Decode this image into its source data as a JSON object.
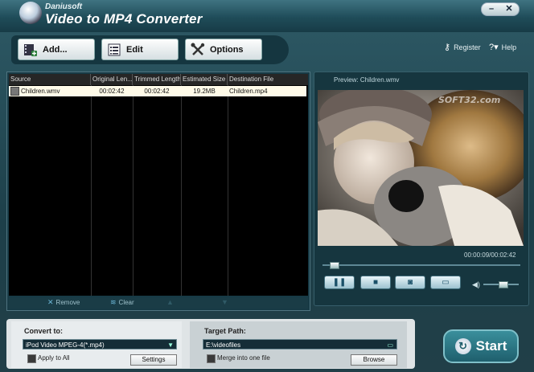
{
  "window": {
    "brand": "Daniusoft",
    "title": "Video to MP4 Converter",
    "controls": {
      "minimize": "–",
      "close": "✕"
    }
  },
  "toolbar": {
    "add_label": "Add...",
    "edit_label": "Edit",
    "options_label": "Options"
  },
  "header_links": {
    "register": "Register",
    "help": "Help"
  },
  "file_list": {
    "columns": [
      "Source",
      "Original Len...",
      "Trimmed Length",
      "Estimated Size",
      "Destination File"
    ],
    "rows": [
      {
        "source": "Children.wmv",
        "original_length": "00:02:42",
        "trimmed_length": "00:02:42",
        "estimated_size": "19.2MB",
        "destination": "Children.mp4"
      }
    ],
    "remove_label": "Remove",
    "clear_label": "Clear"
  },
  "preview": {
    "label": "Preview: Children.wmv",
    "timecode": "00:00:09/00:02:42",
    "watermark": "SOFT32.com",
    "progress_fraction": 0.055,
    "volume_fraction": 0.55
  },
  "convert": {
    "label": "Convert to:",
    "format_value": "iPod Video MPEG-4(*.mp4)",
    "apply_all_label": "Apply to All",
    "settings_label": "Settings"
  },
  "target": {
    "label": "Target Path:",
    "path_value": "E:\\videofiles",
    "merge_label": "Merge into one file",
    "browse_label": "Browse"
  },
  "start_label": "Start",
  "icons": {
    "add": "film-add-icon",
    "edit": "list-edit-icon",
    "options": "tools-icon",
    "register": "key-icon",
    "help": "help-icon"
  },
  "colors": {
    "accent": "#1f5f6d",
    "panel": "#173a45",
    "selected_row": "#fffbe9"
  }
}
